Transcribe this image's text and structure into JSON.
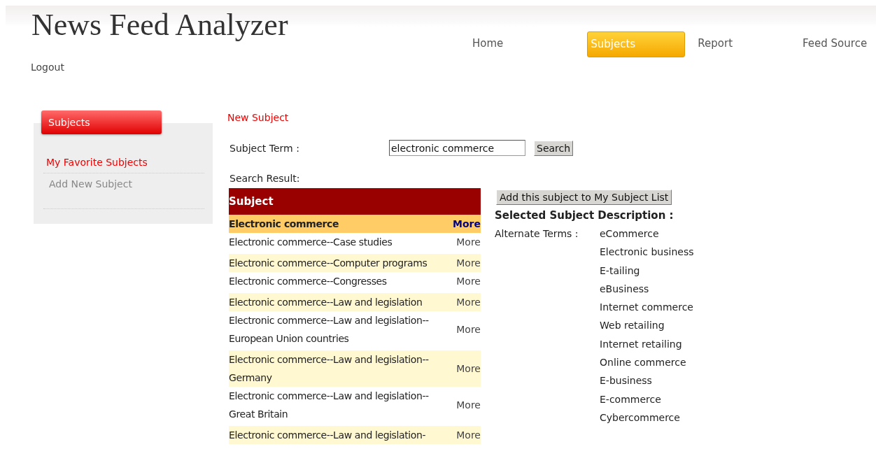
{
  "app_title": "News Feed Analyzer",
  "nav": [
    {
      "label": "Home",
      "selected": false
    },
    {
      "label": "Subjects",
      "selected": true
    },
    {
      "label": "Report",
      "selected": false
    },
    {
      "label": "Feed Source",
      "selected": false
    }
  ],
  "logout": "Logout",
  "sidebar": {
    "title": "Subjects",
    "items": [
      {
        "label": "My Favorite Subjects",
        "selected": true
      },
      {
        "label": "Add New Subject",
        "selected": false
      }
    ]
  },
  "section_title": "New Subject",
  "search": {
    "label": "Subject Term :",
    "value": "electronic commerce",
    "button": "Search"
  },
  "results_label": "Search Result:",
  "table": {
    "columns": [
      "Subject"
    ],
    "rows": [
      {
        "subject": "Electronic commerce",
        "link": "More",
        "selected": true
      },
      {
        "subject": "Electronic commerce--Case studies",
        "link": "More",
        "selected": false
      },
      {
        "subject": "Electronic commerce--Computer programs",
        "link": "More",
        "selected": false
      },
      {
        "subject": "Electronic commerce--Congresses",
        "link": "More",
        "selected": false
      },
      {
        "subject": "Electronic commerce--Law and legislation",
        "link": "More",
        "selected": false
      },
      {
        "subject": "Electronic commerce--Law and legislation--European Union countries",
        "link": "More",
        "selected": false
      },
      {
        "subject": "Electronic commerce--Law and legislation--Germany",
        "link": "More",
        "selected": false
      },
      {
        "subject": "Electronic commerce--Law and legislation--Great Britain",
        "link": "More",
        "selected": false
      },
      {
        "subject": "Electronic commerce--Law and legislation-",
        "link": "More",
        "selected": false
      }
    ]
  },
  "add_button": "Add this subject to My Subject List",
  "description": {
    "title": "Selected Subject Description :",
    "label": "Alternate Terms :",
    "terms": [
      "eCommerce",
      "Electronic business",
      "E-tailing",
      "eBusiness",
      "Internet commerce",
      "Web retailing",
      "Internet retailing",
      "Online commerce",
      "E-business",
      "E-commerce",
      "Cybercommerce"
    ]
  }
}
